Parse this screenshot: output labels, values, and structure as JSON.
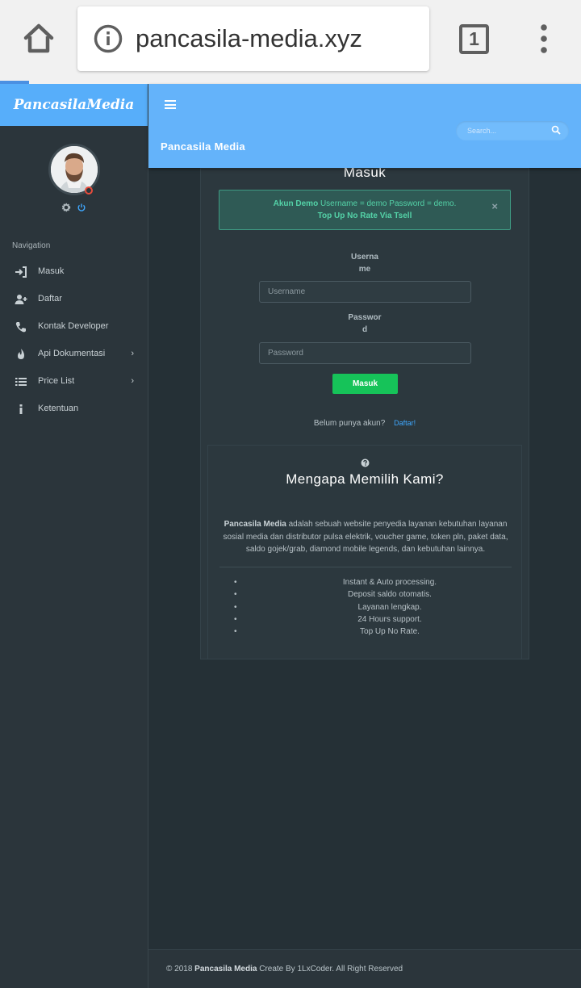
{
  "browser": {
    "url": "pancasila-media.xyz",
    "tab_count": "1"
  },
  "sidebar": {
    "brand": "PancasilaMedia",
    "nav_heading": "Navigation",
    "items": [
      {
        "label": "Masuk",
        "icon": "sign-in-icon"
      },
      {
        "label": "Daftar",
        "icon": "user-plus-icon"
      },
      {
        "label": "Kontak Developer",
        "icon": "phone-icon"
      },
      {
        "label": "Api Dokumentasi",
        "icon": "fire-icon",
        "chevron": "›"
      },
      {
        "label": "Price List",
        "icon": "list-icon",
        "chevron": "›"
      },
      {
        "label": "Ketentuan",
        "icon": "info-icon"
      }
    ]
  },
  "topbar": {
    "title": "Pancasila Media",
    "search_placeholder": "Search..."
  },
  "login": {
    "title": "Masuk",
    "alert_bold": "Akun Demo",
    "alert_text": " Username = demo Password = demo.",
    "alert_line2": "Top Up No Rate Via Tsell",
    "alert_close": "×",
    "username_label_1": "Userna",
    "username_label_2": "me",
    "username_placeholder": "Username",
    "password_label_1": "Passwor",
    "password_label_2": "d",
    "password_placeholder": "Password",
    "submit": "Masuk",
    "register_prompt": "Belum punya akun?",
    "register_link": "Daftar!"
  },
  "why": {
    "title": "Mengapa Memilih Kami?",
    "brand": "Pancasila Media",
    "description": " adalah sebuah website penyedia layanan kebutuhan layanan sosial media dan distributor pulsa elektrik, voucher game, token pln, paket data, saldo gojek/grab, diamond mobile legends, dan kebutuhan lainnya.",
    "features": [
      "Instant & Auto processing.",
      "Deposit saldo otomatis.",
      "Layanan lengkap.",
      "24 Hours support.",
      "Top Up No Rate."
    ]
  },
  "footer": {
    "prefix": "© 2018 ",
    "brand": "Pancasila Media",
    "suffix": " Create By 1LxCoder. All Right Reserved"
  },
  "colors": {
    "brand_blue": "#57aefa",
    "topbar_blue": "#64b3fa",
    "sidebar_bg": "#2b353b",
    "main_bg": "#253036",
    "success_green": "#16c359",
    "alert_text": "#54d3a8"
  }
}
